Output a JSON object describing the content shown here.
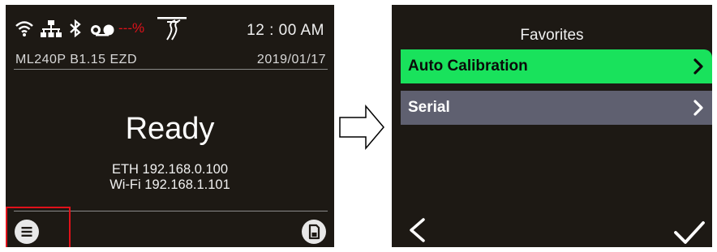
{
  "home": {
    "time": "12 : 00 AM",
    "battery_text": "---%",
    "model_firmware": "ML240P  B1.15  EZD",
    "date": "2019/01/17",
    "status": "Ready",
    "eth_line": "ETH 192.168.0.100",
    "wifi_line": "Wi-Fi 192.168.1.101",
    "icons": [
      "wifi-icon",
      "ethernet-icon",
      "bluetooth-icon",
      "ribbon-icon",
      "print-head-icon",
      "menu-icon",
      "memory-card-icon"
    ]
  },
  "favorites": {
    "title": "Favorites",
    "items": [
      {
        "label": "Auto Calibration",
        "selected": true
      },
      {
        "label": "Serial",
        "selected": false
      }
    ],
    "footer_icons": [
      "back-chevron-icon",
      "checkmark-icon"
    ]
  },
  "colors": {
    "screen_bg": "#1d1914",
    "selected_item": "#19e25c",
    "item_bg": "#5f6070",
    "battery_text": "#e0111a",
    "highlight_box": "#e0111a"
  }
}
